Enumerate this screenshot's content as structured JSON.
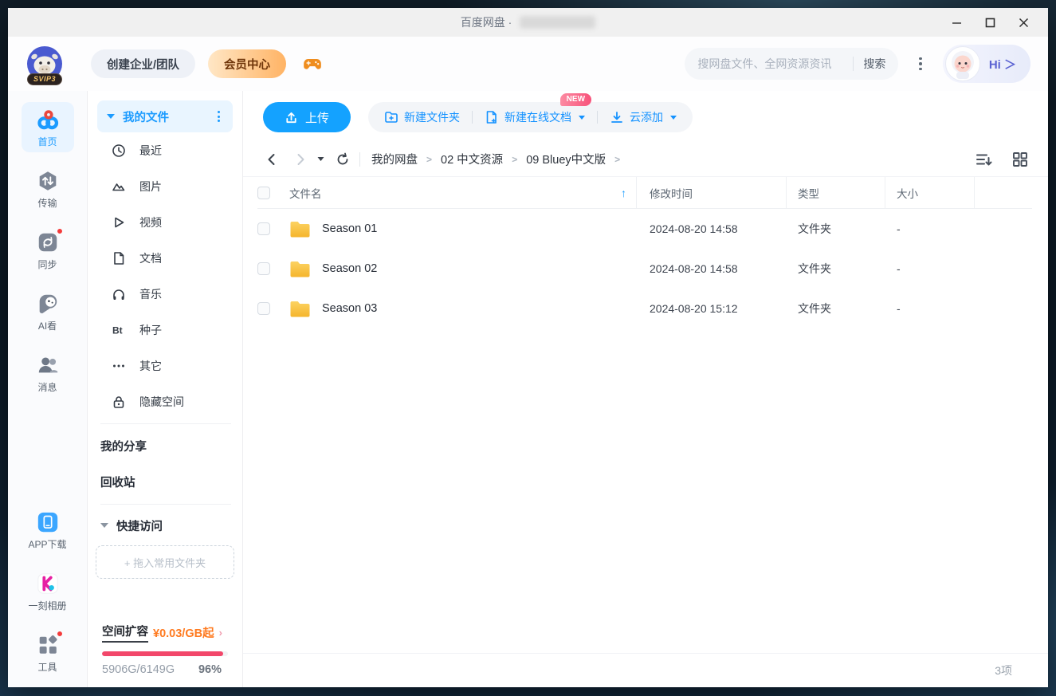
{
  "window": {
    "title": "百度网盘 ·",
    "controls": {
      "minimize": "minimize",
      "maximize": "maximize",
      "close": "close"
    }
  },
  "header": {
    "vip_badge": "SVIP3",
    "create_team": "创建企业/团队",
    "vip_center": "会员中心",
    "search": {
      "placeholder": "搜网盘文件、全网资源资讯",
      "button": "搜索"
    },
    "assistant": "Hi ＞"
  },
  "rail": {
    "items": [
      {
        "label": "首页",
        "active": true
      },
      {
        "label": "传输",
        "active": false
      },
      {
        "label": "同步",
        "active": false,
        "badge": true
      },
      {
        "label": "AI看",
        "active": false
      },
      {
        "label": "消息",
        "active": false
      }
    ],
    "bottom": [
      {
        "label": "APP下载"
      },
      {
        "label": "一刻相册"
      },
      {
        "label": "工具",
        "badge": true
      }
    ]
  },
  "nav": {
    "section_title": "我的文件",
    "items": [
      "最近",
      "图片",
      "视频",
      "文档",
      "音乐",
      "种子",
      "其它",
      "隐藏空间"
    ],
    "links": [
      "我的分享",
      "回收站"
    ],
    "quick_access": "快捷访问",
    "drop_hint": "+ 拖入常用文件夹",
    "storage": {
      "title": "空间扩容",
      "price": "¥0.03/GB起",
      "arrow": "›",
      "usage": "5906G/6149G",
      "percent": "96%",
      "percent_value": 96
    }
  },
  "toolbar": {
    "upload": "上传",
    "new_folder": "新建文件夹",
    "new_doc": "新建在线文档",
    "new_badge": "NEW",
    "cloud_add": "云添加"
  },
  "breadcrumb": {
    "items": [
      "我的网盘",
      "02 中文资源",
      "09 Bluey中文版"
    ]
  },
  "table": {
    "headers": {
      "name": "文件名",
      "time": "修改时间",
      "type": "类型",
      "size": "大小"
    },
    "sort_indicator": "↑",
    "rows": [
      {
        "name": "Season 01",
        "time": "2024-08-20 14:58",
        "type": "文件夹",
        "size": "-"
      },
      {
        "name": "Season 02",
        "time": "2024-08-20 14:58",
        "type": "文件夹",
        "size": "-"
      },
      {
        "name": "Season 03",
        "time": "2024-08-20 15:12",
        "type": "文件夹",
        "size": "-"
      }
    ]
  },
  "footer": {
    "count": "3项"
  },
  "icons": {
    "home": "netdisk-rings",
    "transfer": "hexagon-arrows",
    "sync": "sync-arrows",
    "ai_view": "panda-face",
    "messages": "two-people",
    "app_download": "phone",
    "photos": "yike-album",
    "tools": "grid-blocks",
    "upload": "arrow-up-tray",
    "new_folder": "folder-plus",
    "new_doc": "doc-plus",
    "cloud_add": "download-tray",
    "sort_list": "list-sort-down",
    "grid_view": "four-squares",
    "folder": "yellow-folder",
    "search": "none-shown",
    "game": "gamepad",
    "refresh": "reload-arrow"
  },
  "colors": {
    "accent_blue": "#14a2ff",
    "nav_active": "#1b9bff",
    "vip_gradient_end": "#ffb364",
    "new_badge": "#f7527a",
    "progress_fill": "#f2476a",
    "price_orange": "#ff7a1f",
    "folder_yellow": "#f9c440",
    "red_dot": "#f43b3b"
  }
}
